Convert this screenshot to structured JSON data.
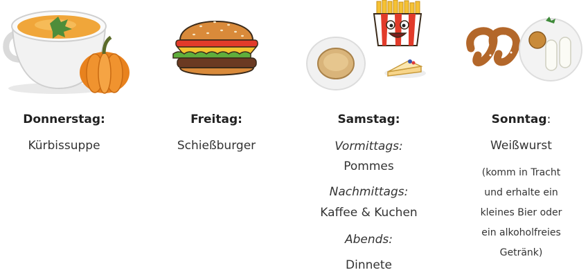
{
  "days": [
    {
      "day": "Donnerstag:",
      "dish": "Kürbissuppe",
      "icons": [
        "soup-bowl-icon",
        "pumpkin-icon"
      ]
    },
    {
      "day": "Freitag:",
      "dish": "Schießburger",
      "icons": [
        "burger-icon"
      ]
    },
    {
      "day": "Samstag:",
      "meals": [
        {
          "time": "Vormittags:",
          "dish": "Pommes"
        },
        {
          "time": "Nachmittags:",
          "dish": "Kaffee & Kuchen"
        },
        {
          "time": "Abends:",
          "dish": "Dinnete"
        }
      ],
      "icons": [
        "flatbread-plate-icon",
        "fries-icon",
        "cheesecake-icon"
      ]
    },
    {
      "day_main": "Sonntag",
      "day_colon": ":",
      "dish": "Weißwurst",
      "note_lines": [
        "(komm in Tracht",
        "und erhalte ein",
        "kleines Bier oder",
        "ein alkoholfreies",
        "Getränk)"
      ],
      "icons": [
        "pretzel-icon",
        "weisswurst-plate-icon"
      ]
    }
  ],
  "colors": {
    "pumpkin": "#e8821e",
    "soup": "#f0a63a",
    "bun": "#d98a3a",
    "text": "#2a2a2a"
  }
}
